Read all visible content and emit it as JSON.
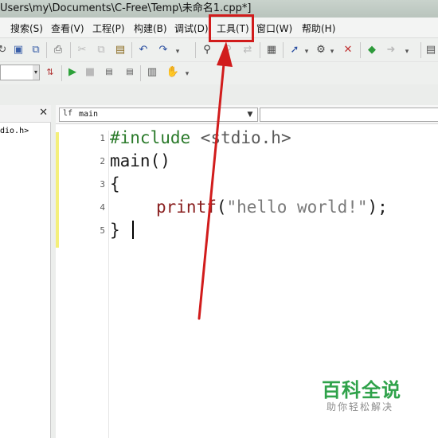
{
  "window": {
    "title": "Users\\my\\Documents\\C-Free\\Temp\\未命名1.cpp*]"
  },
  "menu": {
    "items": [
      {
        "label": "搜索(S)"
      },
      {
        "label": "查看(V)"
      },
      {
        "label": "工程(P)"
      },
      {
        "label": "构建(B)"
      },
      {
        "label": "调试(D)"
      },
      {
        "label": "工具(T)"
      },
      {
        "label": "窗口(W)"
      },
      {
        "label": "帮助(H)"
      }
    ],
    "highlighted": "工具(T)",
    "highlight_color": "#d11c1c"
  },
  "toolbar": {
    "row1_icons": [
      "redo-icon",
      "save-icon",
      "save-all-icon",
      "print-icon",
      "cut-icon",
      "copy-icon",
      "paste-icon",
      "undo-icon",
      "redo-arrow-icon",
      "find-icon",
      "find-next-icon",
      "replace-icon",
      "goto-icon",
      "toggle-bookmark-icon",
      "settings-icon",
      "delete-bookmark-icon",
      "back-icon",
      "forward-icon",
      "new-window-icon"
    ],
    "row2_icons": [
      "config-dropdown",
      "compile-icon",
      "run-icon",
      "stop-icon",
      "build-icon",
      "rebuild-icon",
      "options-icon",
      "hand-icon"
    ]
  },
  "file_panel": {
    "close_glyph": "✕",
    "file_label": "dio.h>"
  },
  "editor": {
    "function_combo": {
      "icon": "lf",
      "value": "main"
    },
    "line_numbers": [
      "1",
      "2",
      "3",
      "4",
      "5"
    ],
    "lines": [
      {
        "pre": "#include",
        "rest": " <stdio.h>"
      },
      {
        "text": "main()"
      },
      {
        "text": "{"
      },
      {
        "fn": "printf",
        "open": "(",
        "str": "\"hello world!\"",
        "close": ");"
      },
      {
        "text": "}"
      }
    ],
    "modified_bar_color": "#f4ef7a"
  },
  "watermark": {
    "title": "百科全说",
    "subtitle": "助你轻松解决"
  },
  "annotation": {
    "arrow_color": "#d11c1c"
  }
}
